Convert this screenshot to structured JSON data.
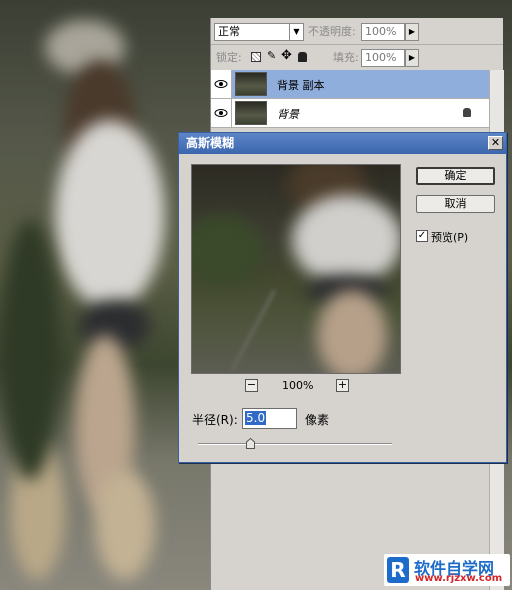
{
  "layers_panel": {
    "blend_mode": "正常",
    "opacity_label": "不透明度:",
    "opacity_value": "100%",
    "lock_label": "锁定:",
    "fill_label": "填充:",
    "fill_value": "100%",
    "layers": [
      {
        "name": "背景 副本",
        "selected": true,
        "locked": false
      },
      {
        "name": "背景",
        "selected": false,
        "locked": true
      }
    ]
  },
  "dialog": {
    "title": "高斯模糊",
    "ok_label": "确定",
    "cancel_label": "取消",
    "preview_label": "预览(P)",
    "preview_checked": true,
    "zoom_minus": "−",
    "zoom_plus": "+",
    "zoom_level": "100%",
    "radius_label": "半径(R):",
    "radius_value": "5.0",
    "radius_unit": "像素",
    "close_glyph": "✕",
    "radius_slider_fraction": 0.27
  },
  "watermark": {
    "logo": "R",
    "name": "软件自学网",
    "url": "www.rjzxw.com"
  },
  "colors": {
    "title_bar": "#4a74ba",
    "selected_layer": "#90aedb",
    "watermark_blue": "#1d6cc9",
    "watermark_red": "#d3262a"
  }
}
